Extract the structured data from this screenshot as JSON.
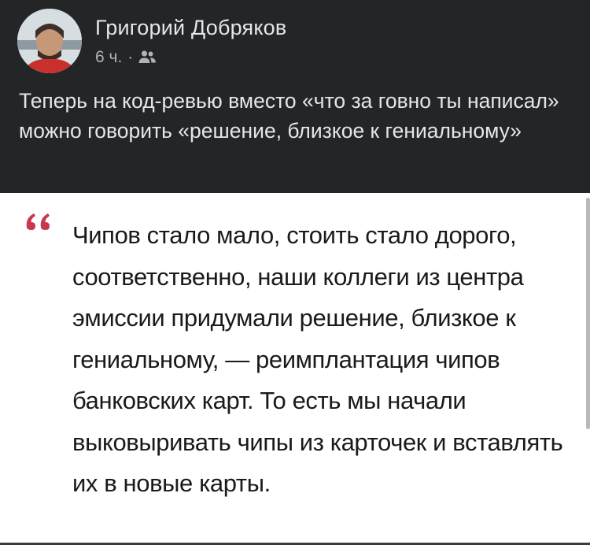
{
  "post": {
    "author": "Григорий Добряков",
    "time": "6 ч.",
    "separator": "·",
    "audience_icon": "friends-icon",
    "text": "Теперь на код-ревью вместо «что за говно ты написал» можно говорить «решение, близкое к гениальному»"
  },
  "quote": {
    "icon": "quote-mark-icon",
    "text": "Чипов стало мало, стоить стало дорого, соответственно, наши коллеги из центра эмиссии придумали решение, близкое к гениальному, — реимплантация чипов банковских карт. То есть мы начали выковыривать чипы из карточек и вставлять их в новые карты."
  },
  "colors": {
    "header_bg": "#242526",
    "name": "#e4e6eb",
    "meta": "#b0b3b8",
    "quote_accent": "#c8394d",
    "quote_bg": "#ffffff"
  }
}
